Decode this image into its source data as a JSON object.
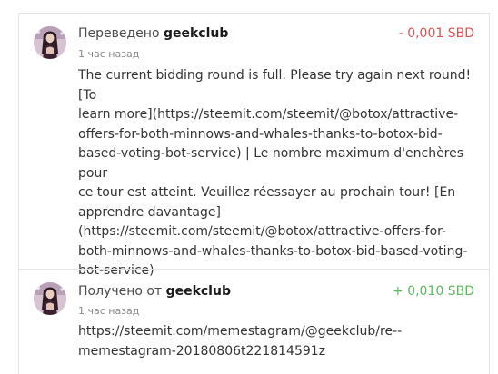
{
  "transactions": [
    {
      "direction_label": "Переведено",
      "user": "geekclub",
      "amount": "- 0,001 SBD",
      "amount_type": "outgoing",
      "time": "1 час назад",
      "memo_lines": [
        "The current bidding round is full. Please try again next round! [To",
        "learn more](https://steemit.com/steemit/@botox/attractive-",
        "offers-for-both-minnows-and-whales-thanks-to-botox-bid-",
        "based-voting-bot-service) | Le nombre maximum d'enchères pour",
        "ce tour est atteint. Veuillez réessayer au prochain tour! [En",
        "apprendre davantage]",
        "(https://steemit.com/steemit/@botox/attractive-offers-for-",
        "both-minnows-and-whales-thanks-to-botox-bid-based-voting-",
        "bot-service)"
      ]
    },
    {
      "direction_label": "Получено от",
      "user": "geekclub",
      "amount": "+ 0,010 SBD",
      "amount_type": "incoming",
      "time": "1 час назад",
      "memo_lines": [
        "https://steemit.com/memestagram/@geekclub/re--",
        "memestagram-20180806t221814591z"
      ]
    }
  ],
  "colors": {
    "negative": "#d9534f",
    "positive": "#5cb85c",
    "border": "#e4e4e4"
  },
  "icons": {
    "avatar": "user-avatar-image"
  }
}
